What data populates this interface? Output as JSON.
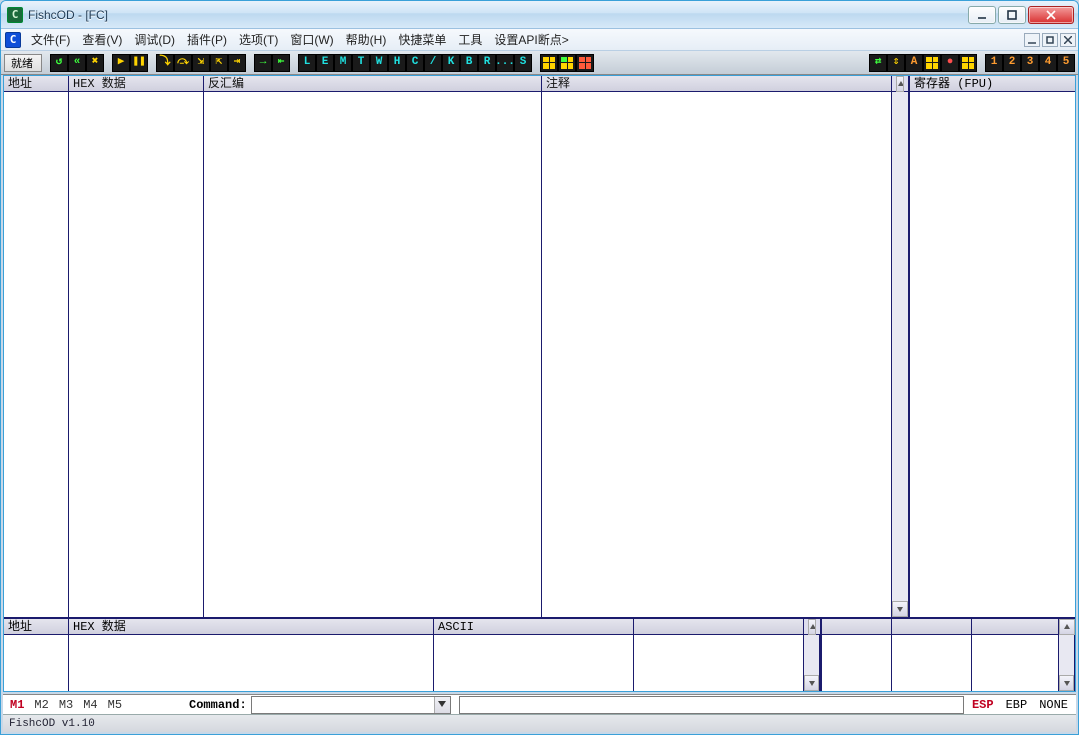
{
  "window": {
    "title": "FishcOD  -  [FC]"
  },
  "menubar": {
    "items": [
      "文件(F)",
      "查看(V)",
      "调试(D)",
      "插件(P)",
      "选项(T)",
      "窗口(W)",
      "帮助(H)",
      "快捷菜单",
      "工具",
      "设置API断点>"
    ]
  },
  "toolbar": {
    "ready": "就绪",
    "letters": [
      "L",
      "E",
      "M",
      "T",
      "W",
      "H",
      "C",
      "/",
      "K",
      "B",
      "R",
      "...",
      "S"
    ],
    "numbers": [
      "1",
      "2",
      "3",
      "4",
      "5"
    ]
  },
  "cpu": {
    "addr": "地址",
    "hex": "HEX 数据",
    "dis": "反汇编",
    "cmt": "注释"
  },
  "registers": {
    "title": "寄存器 (FPU)"
  },
  "dump": {
    "addr": "地址",
    "hex": "HEX 数据",
    "asc": "ASCII"
  },
  "cmdbar": {
    "macros": [
      "M1",
      "M2",
      "M3",
      "M4",
      "M5"
    ],
    "label": "Command:",
    "stack_labels": [
      "ESP",
      "EBP",
      "NONE"
    ]
  },
  "status": "FishcOD v1.10"
}
